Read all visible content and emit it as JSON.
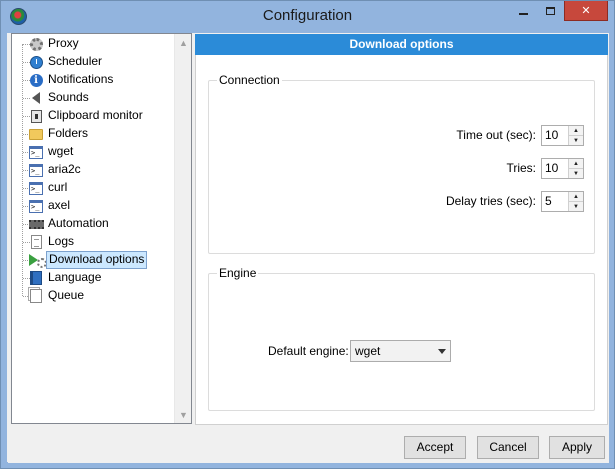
{
  "window": {
    "title": "Configuration"
  },
  "titlebar_buttons": {
    "minimize": "minimize",
    "maximize": "maximize",
    "close": "✕"
  },
  "sidebar": {
    "items": [
      {
        "label": "Proxy",
        "icon": "gear-icon"
      },
      {
        "label": "Scheduler",
        "icon": "clock-icon"
      },
      {
        "label": "Notifications",
        "icon": "info-icon"
      },
      {
        "label": "Sounds",
        "icon": "speaker-icon"
      },
      {
        "label": "Clipboard monitor",
        "icon": "clipboard-icon"
      },
      {
        "label": "Folders",
        "icon": "folder-icon"
      },
      {
        "label": "wget",
        "icon": "terminal-icon"
      },
      {
        "label": "aria2c",
        "icon": "terminal-icon"
      },
      {
        "label": "curl",
        "icon": "terminal-icon"
      },
      {
        "label": "axel",
        "icon": "terminal-icon"
      },
      {
        "label": "Automation",
        "icon": "chip-icon"
      },
      {
        "label": "Logs",
        "icon": "document-icon"
      },
      {
        "label": "Download options",
        "icon": "download-settings-icon",
        "selected": true
      },
      {
        "label": "Language",
        "icon": "book-icon"
      },
      {
        "label": "Queue",
        "icon": "pages-icon"
      }
    ]
  },
  "panel": {
    "header": "Download options",
    "connection": {
      "title": "Connection",
      "timeout_label": "Time out (sec):",
      "timeout_value": "10",
      "tries_label": "Tries:",
      "tries_value": "10",
      "delay_label": "Delay tries  (sec):",
      "delay_value": "5"
    },
    "engine": {
      "title": "Engine",
      "default_label": "Default engine:",
      "default_value": "wget"
    }
  },
  "footer": {
    "accept": "Accept",
    "cancel": "Cancel",
    "apply": "Apply"
  }
}
